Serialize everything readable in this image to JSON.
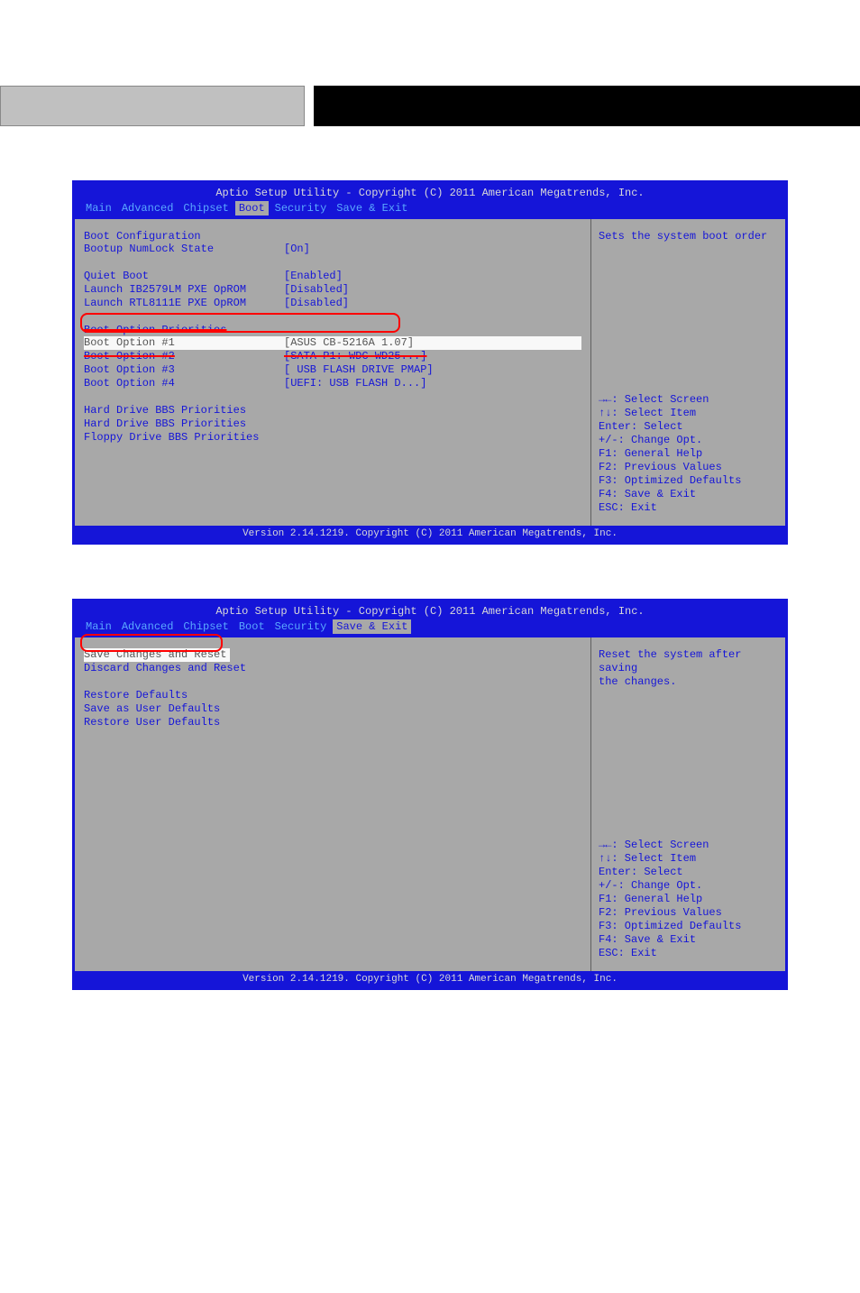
{
  "header": {
    "title": "Aptio Setup Utility - Copyright (C) 2011 American Megatrends, Inc.",
    "footer": "Version 2.14.1219. Copyright (C) 2011 American Megatrends, Inc."
  },
  "tabs": {
    "main": "Main",
    "advanced": "Advanced",
    "chipset": "Chipset",
    "boot": "Boot",
    "security": "Security",
    "save_exit": "Save & Exit"
  },
  "screen1": {
    "section_heading": "Boot Configuration",
    "rows": {
      "numlock": {
        "label": "Bootup NumLock State",
        "value": "[On]"
      },
      "quiet": {
        "label": "Quiet Boot",
        "value": "[Enabled]"
      },
      "pxe1": {
        "label": "Launch IB2579LM PXE OpROM",
        "value": "[Disabled]"
      },
      "pxe2": {
        "label": "Launch RTL8111E PXE OpROM",
        "value": "[Disabled]"
      },
      "priorities_heading": "Boot Option Priorities",
      "opt1": {
        "label": "Boot Option #1",
        "value": "[ASUS CB-5216A 1.07]"
      },
      "opt2": {
        "label": "Boot Option #2",
        "value": "[SATA  P1: WDC WD25...]"
      },
      "opt3": {
        "label": "Boot Option #3",
        "value": "[ USB FLASH DRIVE PMAP]"
      },
      "opt4": {
        "label": "Boot Option #4",
        "value": "[UEFI:  USB FLASH D...]"
      },
      "hdd_bbs1": "Hard Drive BBS Priorities",
      "hdd_bbs2": "Hard Drive BBS Priorities",
      "floppy_bbs": "Floppy Drive BBS Priorities"
    },
    "help_text": "Sets the system boot order"
  },
  "screen2": {
    "rows": {
      "save_reset": "Save Changes and Reset",
      "discard_reset": "Discard Changes and Reset",
      "restore_defaults": "Restore Defaults",
      "save_user_defaults": "Save as User Defaults",
      "restore_user_defaults": "Restore User Defaults"
    },
    "help_text1": "Reset the system after saving",
    "help_text2": "the changes."
  },
  "help_keys": {
    "select_screen": "→←: Select Screen",
    "select_item": "↑↓: Select Item",
    "enter": "Enter: Select",
    "change": "+/-: Change Opt.",
    "general": "F1: General Help",
    "previous": "F2: Previous Values",
    "optimized": "F3: Optimized Defaults",
    "save": "F4: Save & Exit",
    "exit": "ESC: Exit"
  }
}
